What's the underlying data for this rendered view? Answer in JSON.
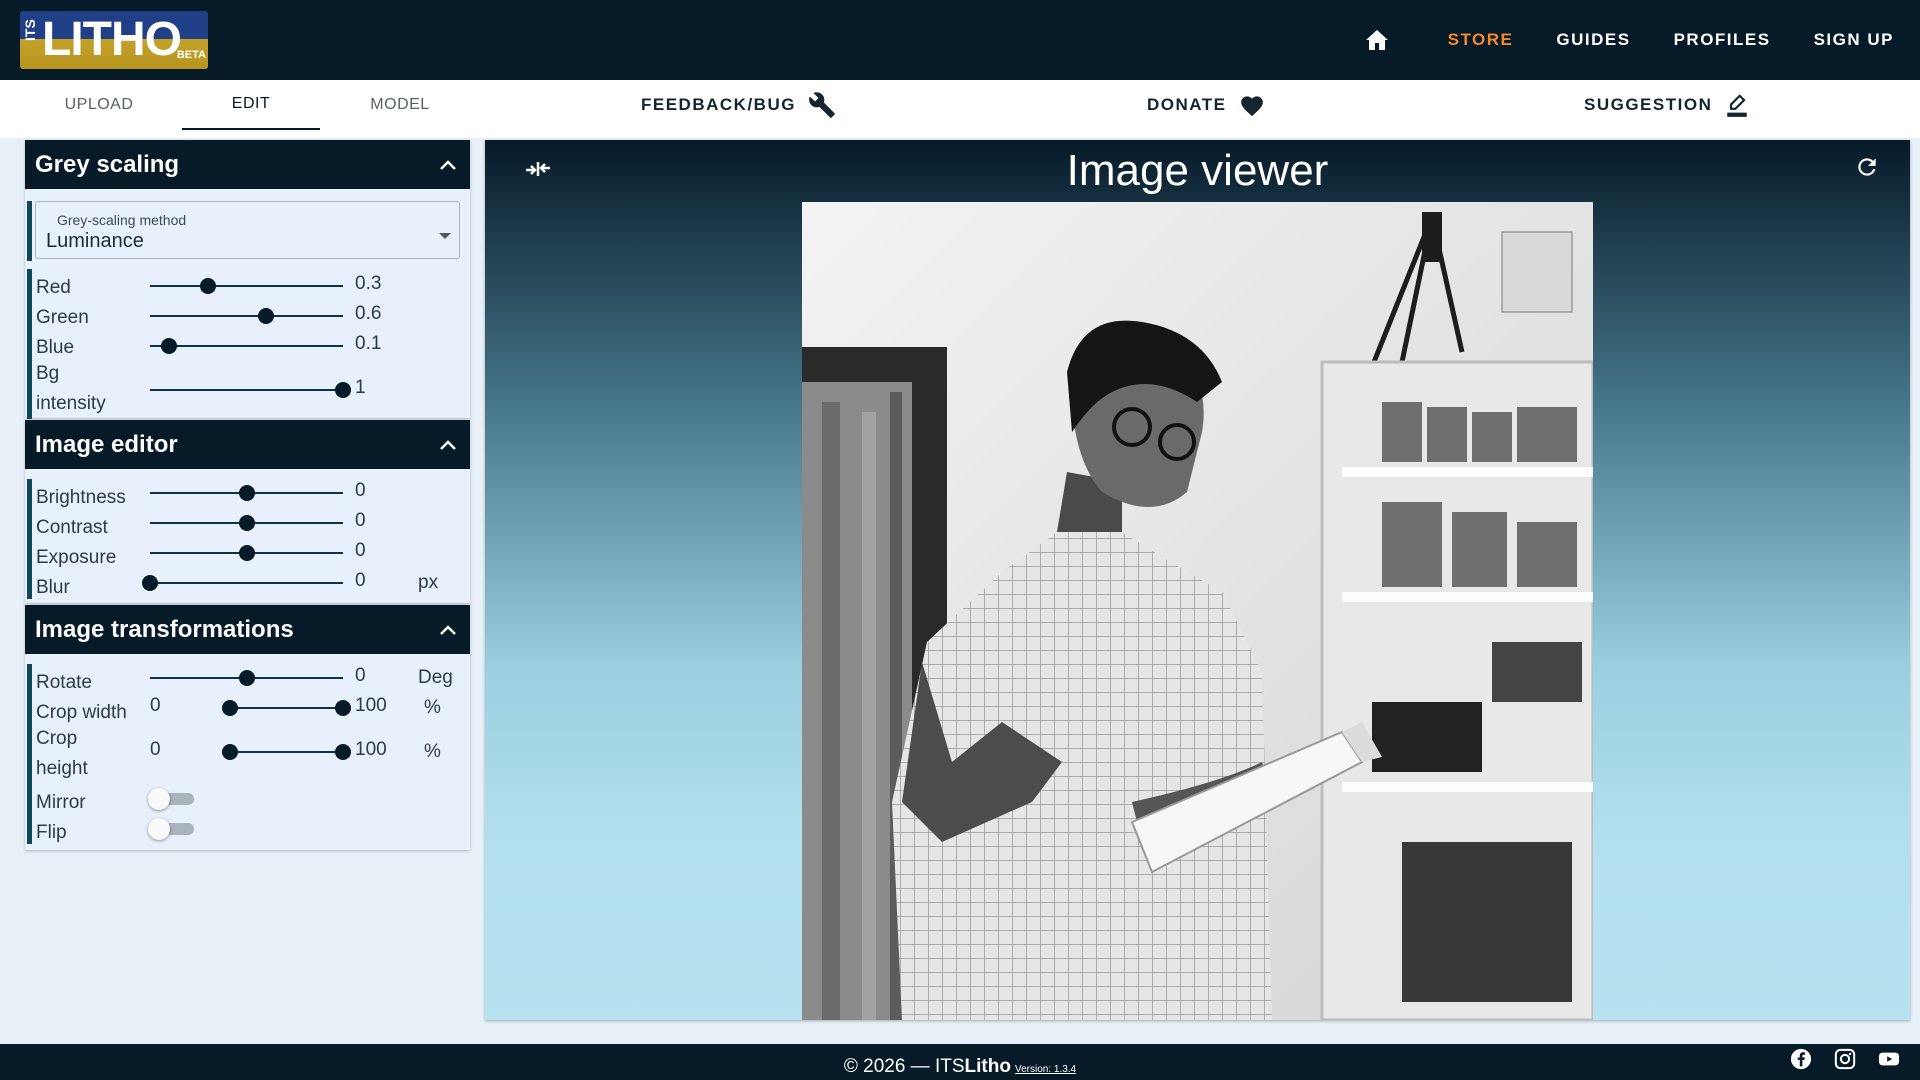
{
  "brand": {
    "logo_its": "ITS",
    "logo_main": "LITHO",
    "logo_beta": "BETA"
  },
  "nav": {
    "store": "STORE",
    "guides": "GUIDES",
    "profiles": "PROFILES",
    "signup": "SIGN UP"
  },
  "tabs": {
    "upload": "UPLOAD",
    "edit": "EDIT",
    "model": "MODEL"
  },
  "actions": {
    "feedback": "FEEDBACK/BUG",
    "donate": "DONATE",
    "suggestion": "SUGGESTION"
  },
  "grey": {
    "title": "Grey scaling",
    "method_label": "Grey-scaling method",
    "method_value": "Luminance",
    "red": {
      "label": "Red",
      "value": "0.3",
      "fraction": 0.3
    },
    "green": {
      "label": "Green",
      "value": "0.6",
      "fraction": 0.6
    },
    "blue": {
      "label": "Blue",
      "value": "0.1",
      "fraction": 0.1
    },
    "bg": {
      "label_1": "Bg",
      "label_2": "intensity",
      "value": "1",
      "fraction": 1
    }
  },
  "editor": {
    "title": "Image editor",
    "brightness": {
      "label": "Brightness",
      "value": "0",
      "fraction": 0.5
    },
    "contrast": {
      "label": "Contrast",
      "value": "0",
      "fraction": 0.5
    },
    "exposure": {
      "label": "Exposure",
      "value": "0",
      "fraction": 0.5
    },
    "blur": {
      "label": "Blur",
      "value": "0",
      "unit": "px",
      "fraction": 0
    }
  },
  "transform": {
    "title": "Image transformations",
    "rotate": {
      "label": "Rotate",
      "value": "0",
      "unit": "Deg",
      "fraction": 0.5
    },
    "crop_width": {
      "label": "Crop width",
      "min": "0",
      "max": "100",
      "unit": "%"
    },
    "crop_height": {
      "label_1": "Crop",
      "label_2": "height",
      "min": "0",
      "max": "100",
      "unit": "%"
    },
    "mirror": {
      "label": "Mirror",
      "on": false
    },
    "flip": {
      "label": "Flip",
      "on": false
    }
  },
  "viewer": {
    "title": "Image viewer"
  },
  "footer": {
    "copyright": "© 2026 — ITS",
    "brand_bold": "Litho",
    "version": "Version: 1.3.4"
  }
}
